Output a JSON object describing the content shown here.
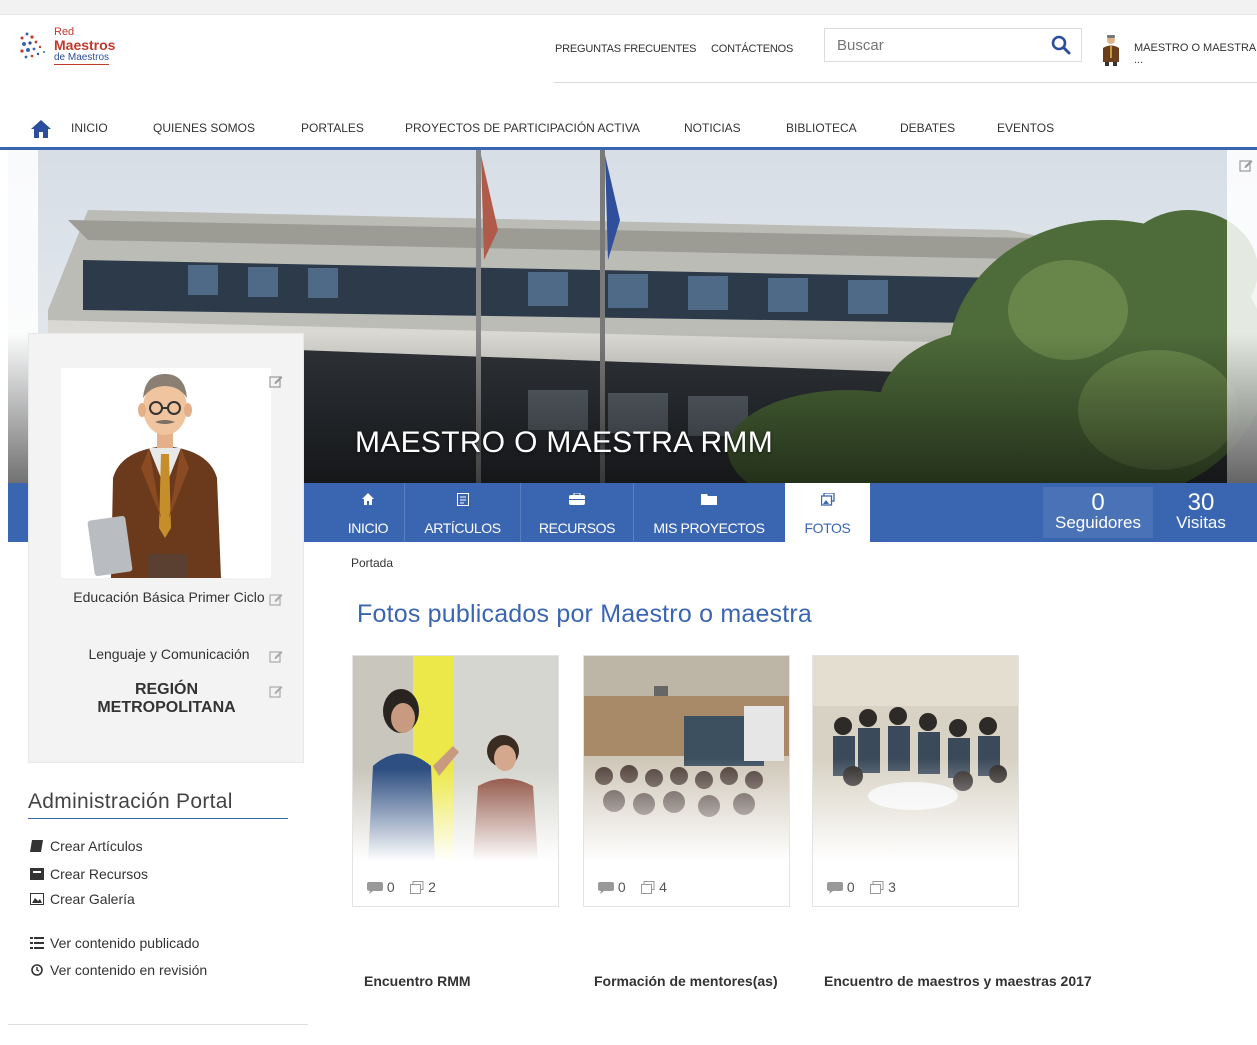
{
  "brand": {
    "line1": "Red",
    "line2": "Maestros",
    "line3": "de Maestros"
  },
  "header": {
    "links": [
      "PREGUNTAS FRECUENTES",
      "CONTÁCTENOS"
    ],
    "search_placeholder": "Buscar",
    "user_name": "MAESTRO O MAESTRA ..."
  },
  "nav": {
    "items": [
      "INICIO",
      "QUIENES SOMOS",
      "PORTALES",
      "PROYECTOS DE PARTICIPACIÓN ACTIVA",
      "NOTICIAS",
      "BIBLIOTECA",
      "DEBATES",
      "EVENTOS"
    ]
  },
  "banner": {
    "title": "MAESTRO O MAESTRA RMM"
  },
  "tabs": [
    {
      "label": "INICIO",
      "icon": "home-icon"
    },
    {
      "label": "ARTÍCULOS",
      "icon": "article-icon"
    },
    {
      "label": "RECURSOS",
      "icon": "resources-icon"
    },
    {
      "label": "MIS PROYECTOS",
      "icon": "folder-icon"
    },
    {
      "label": "FOTOS",
      "icon": "photo-icon",
      "active": true
    }
  ],
  "stats": {
    "followers_count": "0",
    "followers_label": "Seguidores",
    "visits_count": "30",
    "visits_label": "Visitas"
  },
  "profile": {
    "level": "Educación Básica Primer Ciclo",
    "subject": "Lenguaje y Comunicación",
    "region": "REGIÓN METROPOLITANA"
  },
  "admin": {
    "title": "Administración Portal",
    "links": [
      "Crear Artículos",
      "Crear Recursos",
      "Crear Galería",
      "Ver contenido publicado",
      "Ver contenido en revisión"
    ]
  },
  "breadcrumb": "Portada",
  "page_title": "Fotos publicados por Maestro o maestra",
  "galleries": [
    {
      "title": "Encuentro RMM",
      "likes": "0",
      "photos": "2"
    },
    {
      "title": "Formación de mentores(as)",
      "likes": "0",
      "photos": "4"
    },
    {
      "title": "Encuentro de maestros y maestras 2017",
      "likes": "0",
      "photos": "3"
    }
  ],
  "colors": {
    "primary": "#3a66b1",
    "brand_red": "#c0392b"
  }
}
